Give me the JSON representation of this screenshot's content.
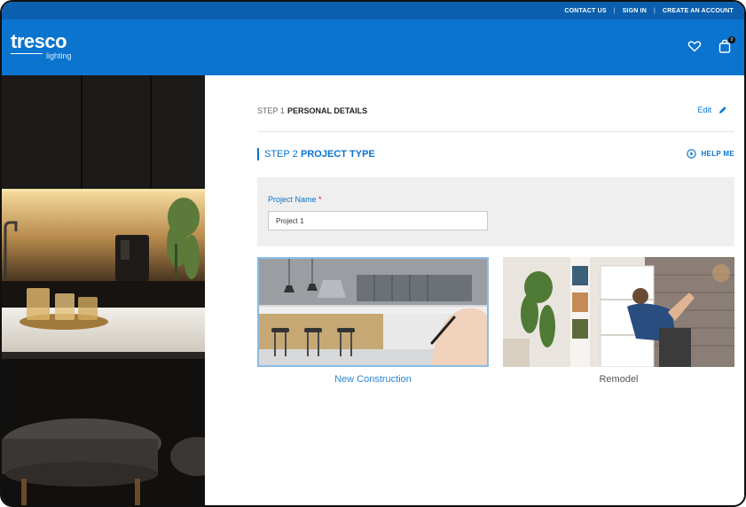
{
  "utility_nav": [
    "CONTACT US",
    "SIGN IN",
    "CREATE AN ACCOUNT"
  ],
  "utility_separator": "|",
  "brand": {
    "name": "tresco",
    "sub": "lighting"
  },
  "header": {
    "cart_count": "0"
  },
  "steps": {
    "step1": {
      "number": "STEP 1",
      "title": "PERSONAL DETAILS",
      "edit_label": "Edit"
    },
    "step2": {
      "number": "STEP 2",
      "title": "PROJECT TYPE",
      "help_label": "HELP ME"
    }
  },
  "project_form": {
    "label": "Project Name",
    "required_mark": "*",
    "value": "Project 1"
  },
  "project_types": [
    {
      "label": "New Construction",
      "selected": true
    },
    {
      "label": "Remodel",
      "selected": false
    }
  ],
  "colors": {
    "utility_bar": "#0b5fae",
    "header": "#0a74cf",
    "accent": "#0a74cf",
    "required": "#d32121"
  }
}
